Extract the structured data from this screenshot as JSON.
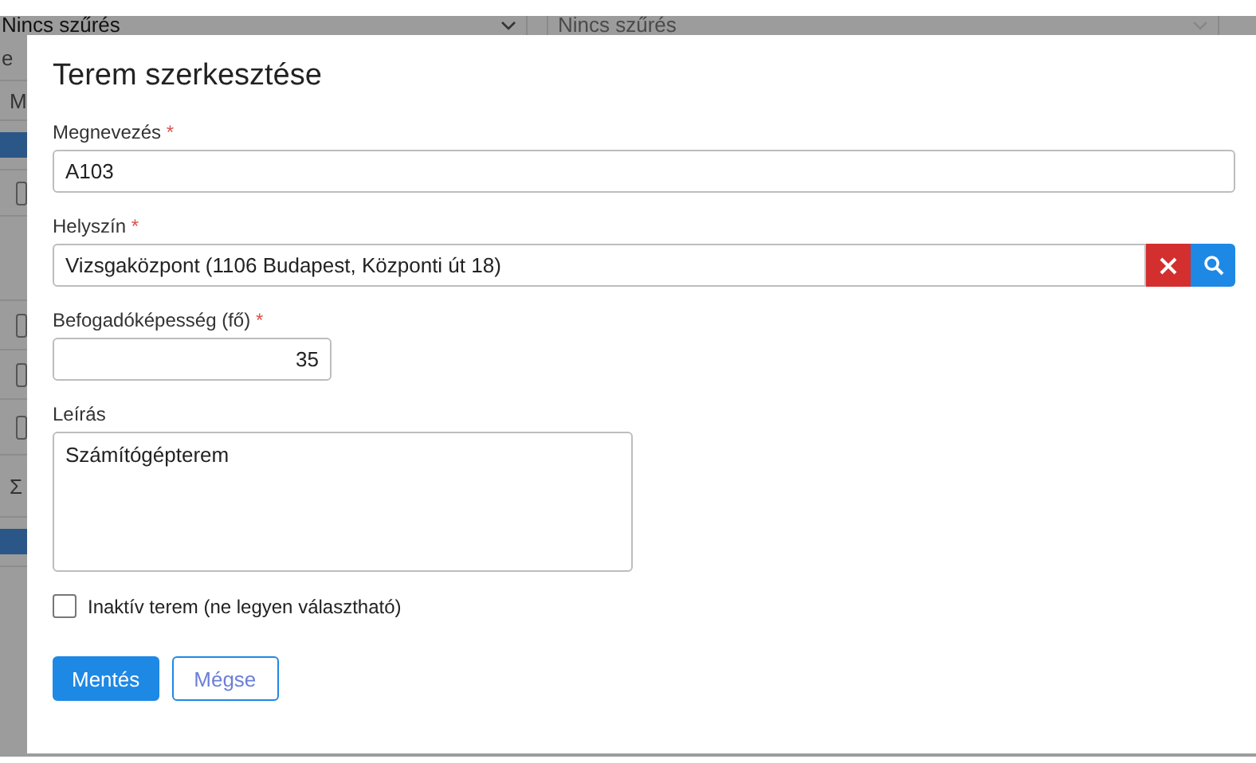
{
  "background": {
    "filters": [
      {
        "value": "Nincs szűrés",
        "disabled": false
      },
      {
        "value": "Nincs szűrés",
        "disabled": true
      }
    ],
    "fragments": [
      {
        "kind": "text",
        "text": "e"
      },
      {
        "kind": "text",
        "text": "M"
      },
      {
        "kind": "bar"
      },
      {
        "kind": "checkbox",
        "checked": false
      },
      {
        "kind": "blank"
      },
      {
        "kind": "checkbox",
        "checked": false
      },
      {
        "kind": "checkbox",
        "checked": false
      },
      {
        "kind": "checkbox",
        "checked": false
      },
      {
        "kind": "text",
        "text": "Σ"
      },
      {
        "kind": "bar"
      }
    ]
  },
  "dialog": {
    "title": "Terem szerkesztése",
    "fields": [
      {
        "kind": "text",
        "label": "Megnevezés",
        "required_mark": "*",
        "value": "A103"
      },
      {
        "kind": "lookup",
        "label": "Helyszín",
        "required_mark": "*",
        "value": "Vizsgaközpont (1106 Budapest, Központi út 18)"
      },
      {
        "kind": "number",
        "label": "Befogadóképesség (fő)",
        "required_mark": "*",
        "value": "35"
      },
      {
        "kind": "textarea",
        "label": "Leírás",
        "value": "Számítógépterem"
      }
    ],
    "inactive": {
      "label": "Inaktív terem (ne legyen választható)",
      "checked": false
    },
    "buttons": [
      {
        "label": "Mentés",
        "kind": "primary"
      },
      {
        "label": "Mégse",
        "kind": "secondary"
      }
    ]
  }
}
